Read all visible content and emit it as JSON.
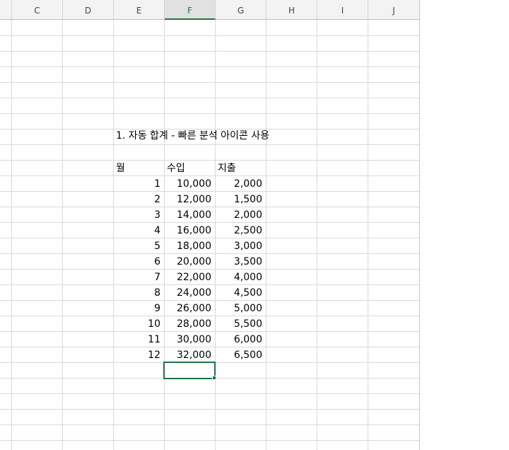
{
  "columns": [
    "C",
    "D",
    "E",
    "F",
    "G",
    "H",
    "I",
    "J"
  ],
  "selected_column": "F",
  "title": "1. 자동 합계 - 빠른 분석 아이콘 사용",
  "table": {
    "headers": [
      "월",
      "수입",
      "지출"
    ],
    "rows": [
      [
        "1",
        "10,000",
        "2,000"
      ],
      [
        "2",
        "12,000",
        "1,500"
      ],
      [
        "3",
        "14,000",
        "2,000"
      ],
      [
        "4",
        "16,000",
        "2,500"
      ],
      [
        "5",
        "18,000",
        "3,000"
      ],
      [
        "6",
        "20,000",
        "3,500"
      ],
      [
        "7",
        "22,000",
        "4,000"
      ],
      [
        "8",
        "24,000",
        "4,500"
      ],
      [
        "9",
        "26,000",
        "5,000"
      ],
      [
        "10",
        "28,000",
        "5,500"
      ],
      [
        "11",
        "30,000",
        "6,000"
      ],
      [
        "12",
        "32,000",
        "6,500"
      ]
    ]
  },
  "colors": {
    "selection": "#217346",
    "gridline": "#d9d9d9",
    "header_bg": "#f3f3f3"
  }
}
